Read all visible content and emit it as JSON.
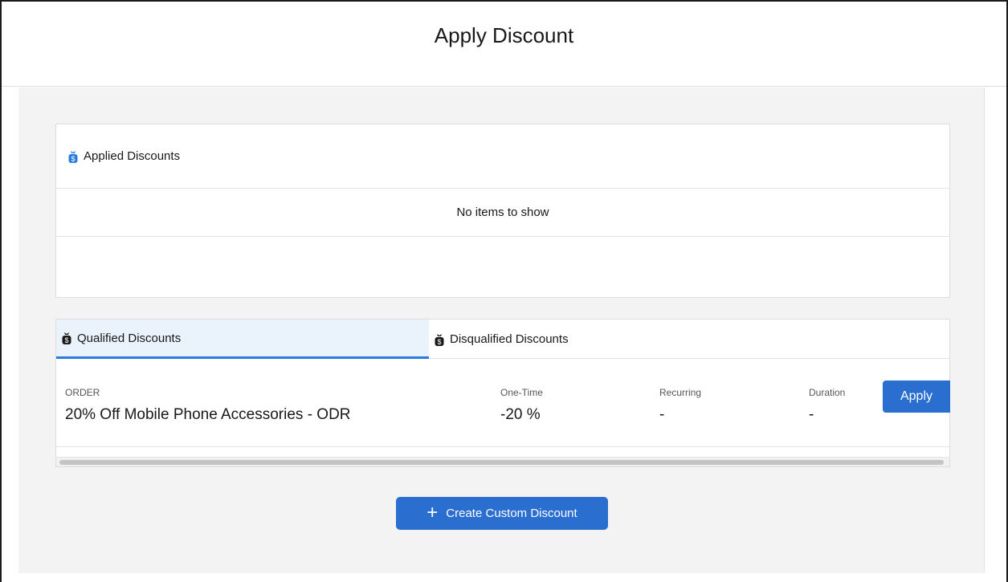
{
  "modal": {
    "title": "Apply Discount"
  },
  "applied": {
    "title": "Applied Discounts",
    "icon": "money-bag-icon",
    "empty_text": "No items to show"
  },
  "tabs": [
    {
      "label": "Qualified Discounts",
      "active": true,
      "icon": "money-bag-icon"
    },
    {
      "label": "Disqualified Discounts",
      "active": false,
      "icon": "money-bag-icon"
    }
  ],
  "discount_rows": [
    {
      "type_label": "ORDER",
      "name": "20% Off Mobile Phone Accessories - ODR",
      "one_time_label": "One-Time",
      "one_time_value": "-20 %",
      "recurring_label": "Recurring",
      "recurring_value": "-",
      "duration_label": "Duration",
      "duration_value": "-",
      "action_label": "Apply"
    }
  ],
  "create_button": {
    "label": "Create Custom Discount",
    "icon": "plus-icon"
  },
  "colors": {
    "accent": "#2a6fd0",
    "tab_active_bg": "#eaf2fc",
    "tab_active_border": "#2a7be0",
    "body_bg": "#f3f3f3"
  }
}
